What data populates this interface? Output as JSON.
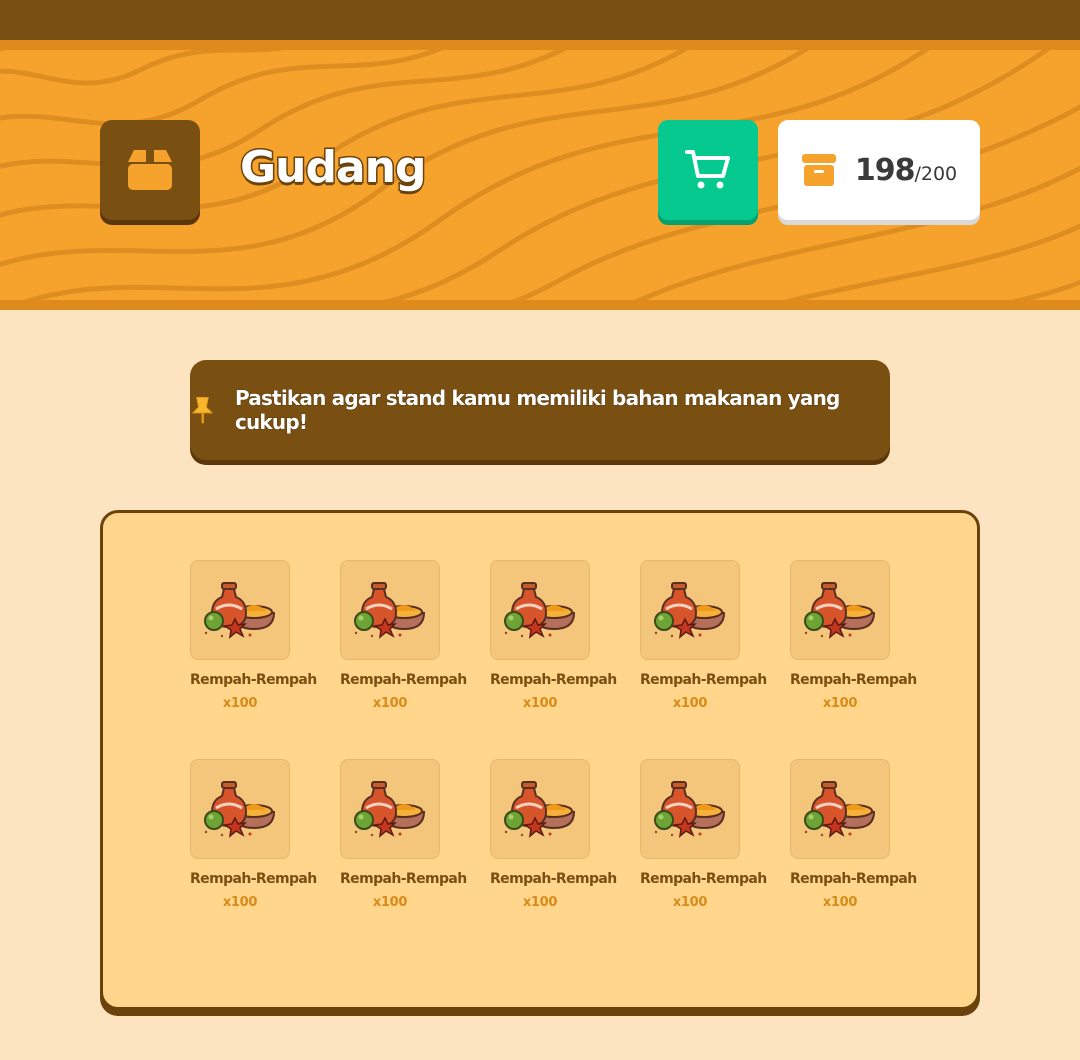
{
  "header": {
    "title": "Gudang",
    "box_icon": "package-icon",
    "cart_icon": "cart-icon",
    "capacity_icon": "archive-icon",
    "capacity_used": "198",
    "capacity_max": "/200",
    "colors": {
      "header_bg": "#f6a32e",
      "dark_brown": "#7a4f12",
      "cart_green": "#05c98e"
    }
  },
  "notice": {
    "icon": "pin-icon",
    "text": "Pastikan agar stand kamu memiliki bahan makanan yang cukup!"
  },
  "inventory": {
    "items": [
      {
        "name": "Rempah-Rempah",
        "qty": "x100",
        "icon": "spices-icon"
      },
      {
        "name": "Rempah-Rempah",
        "qty": "x100",
        "icon": "spices-icon"
      },
      {
        "name": "Rempah-Rempah",
        "qty": "x100",
        "icon": "spices-icon"
      },
      {
        "name": "Rempah-Rempah",
        "qty": "x100",
        "icon": "spices-icon"
      },
      {
        "name": "Rempah-Rempah",
        "qty": "x100",
        "icon": "spices-icon"
      },
      {
        "name": "Rempah-Rempah",
        "qty": "x100",
        "icon": "spices-icon"
      },
      {
        "name": "Rempah-Rempah",
        "qty": "x100",
        "icon": "spices-icon"
      },
      {
        "name": "Rempah-Rempah",
        "qty": "x100",
        "icon": "spices-icon"
      },
      {
        "name": "Rempah-Rempah",
        "qty": "x100",
        "icon": "spices-icon"
      },
      {
        "name": "Rempah-Rempah",
        "qty": "x100",
        "icon": "spices-icon"
      }
    ]
  }
}
